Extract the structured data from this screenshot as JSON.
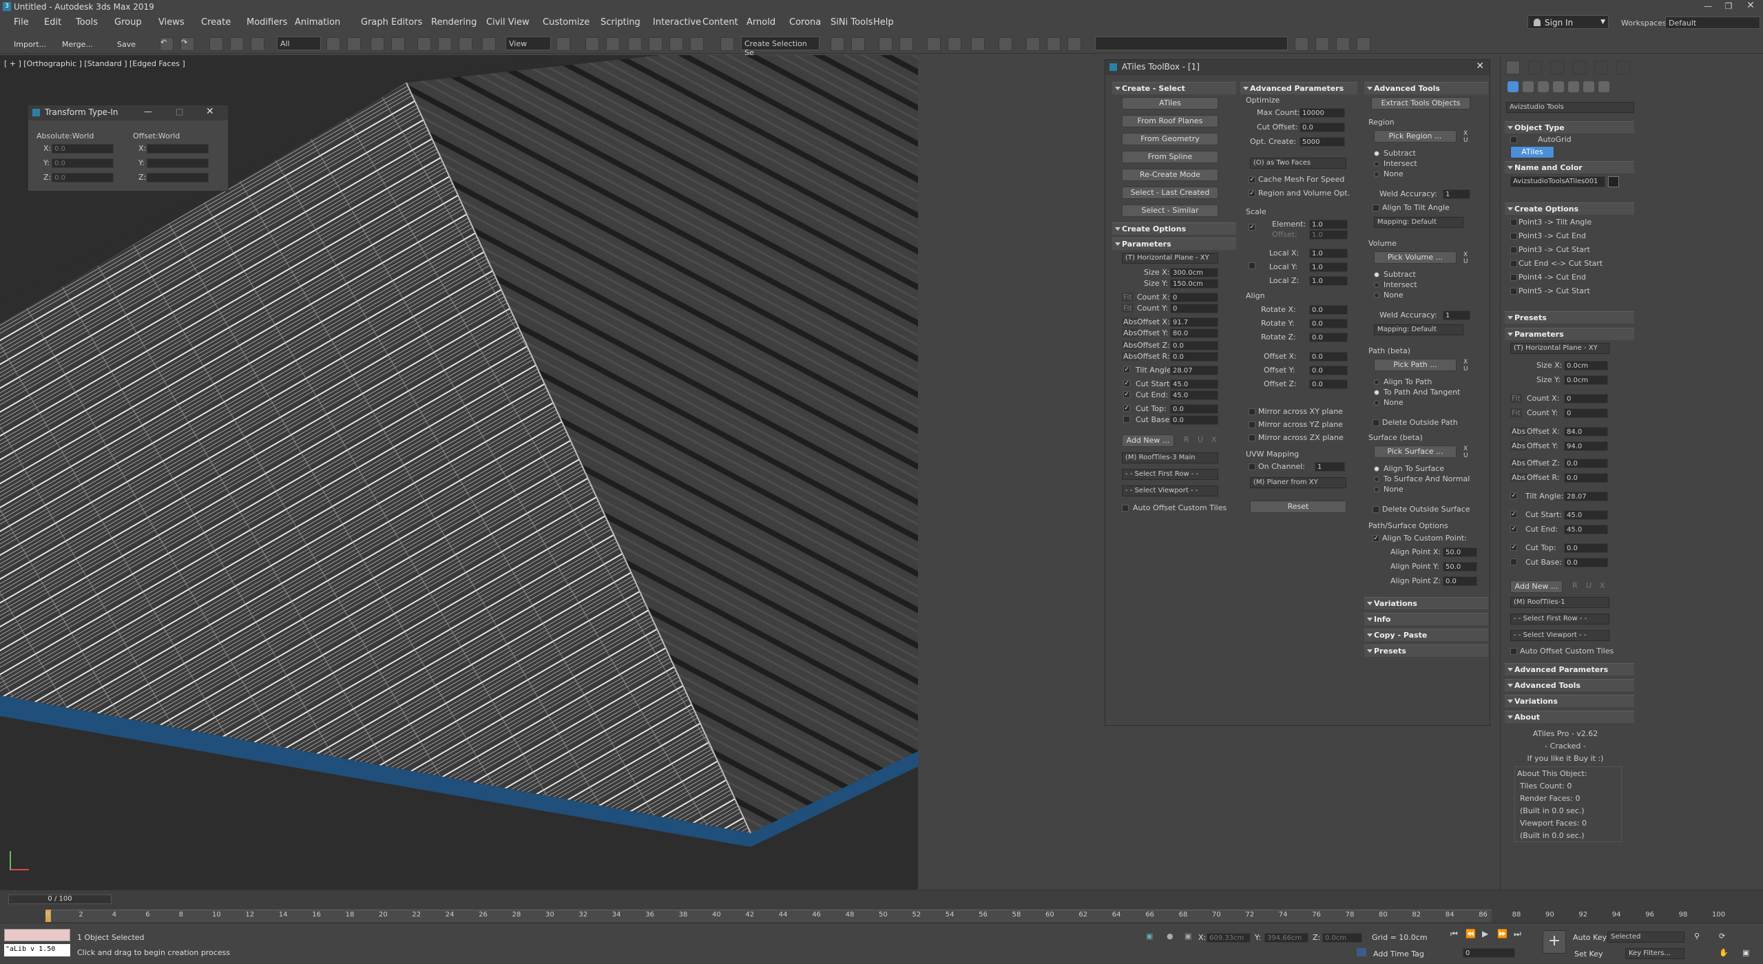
{
  "app": {
    "title": "Untitled - Autodesk 3ds Max 2019"
  },
  "menu": [
    "File",
    "Edit",
    "Tools",
    "Group",
    "Views",
    "Create",
    "Modifiers",
    "Animation",
    "Graph Editors",
    "Rendering",
    "Civil View",
    "Customize",
    "Scripting",
    "Interactive",
    "Content",
    "Arnold",
    "Corona",
    "SiNi Tools",
    "Help"
  ],
  "topright": {
    "signin": "Sign In",
    "workspaces_label": "Workspaces:",
    "workspaces_value": "Default"
  },
  "toolbar": {
    "import": "Import...",
    "merge": "Merge...",
    "save": "Save",
    "filter": "All",
    "refcoord": "View",
    "selset": "Create Selection Se"
  },
  "viewport": {
    "label": "[ + ] [Orthographic ] [Standard ] [Edged Faces ]"
  },
  "transform": {
    "title": "Transform Type-In",
    "abs_label": "Absolute:World",
    "off_label": "Offset:World",
    "abs": [
      {
        "axis": "X:",
        "val": "0.0"
      },
      {
        "axis": "Y:",
        "val": "0.0"
      },
      {
        "axis": "Z:",
        "val": "0.0"
      }
    ],
    "off": [
      {
        "axis": "X:",
        "val": ""
      },
      {
        "axis": "Y:",
        "val": ""
      },
      {
        "axis": "Z:",
        "val": ""
      }
    ]
  },
  "toolbox": {
    "title": "ATiles ToolBox - [1]",
    "col1": {
      "create_select": "Create - Select",
      "buttons": [
        "ATiles",
        "From Roof Planes",
        "From Geometry",
        "From Spline",
        "Re-Create Mode",
        "Select - Last Created",
        "Select - Similar"
      ],
      "create_options": "Create Options",
      "parameters": "Parameters",
      "plane": "(T) Horizontal Plane - XY",
      "params": [
        {
          "pre": "",
          "label": "Size X:",
          "val": "300.0cm"
        },
        {
          "pre": "",
          "label": "Size Y:",
          "val": "150.0cm"
        },
        {
          "pre": "Fit",
          "label": "Count X:",
          "val": "0"
        },
        {
          "pre": "Fit",
          "label": "Count Y:",
          "val": "0"
        },
        {
          "pre": "Abs",
          "label": "Offset X:",
          "val": "91.7"
        },
        {
          "pre": "Abs",
          "label": "Offset Y:",
          "val": "80.0"
        },
        {
          "pre": "Abs",
          "label": "Offset Z:",
          "val": "0.0"
        },
        {
          "pre": "Abs",
          "label": "Offset R:",
          "val": "0.0"
        },
        {
          "pre": "chk",
          "label": "Tilt Angle:",
          "val": "28.07"
        },
        {
          "pre": "chk",
          "label": "Cut Start:",
          "val": "45.0"
        },
        {
          "pre": "chk",
          "label": "Cut End:",
          "val": "45.0"
        },
        {
          "pre": "chk",
          "label": "Cut Top:",
          "val": "0.0"
        },
        {
          "pre": "box",
          "label": "Cut Base:",
          "val": "0.0"
        }
      ],
      "add_new": "Add New ...",
      "rux": [
        "R",
        "U",
        "X"
      ],
      "preset": "(M) RoofTiles-3 Main",
      "first_row": "- - Select First Row - -",
      "viewport_sel": "- - Select Viewport - -",
      "auto_offset": "Auto Offset Custom Tiles"
    },
    "col2": {
      "header": "Advanced Parameters",
      "optimize": "Optimize",
      "opt": [
        {
          "label": "Max Count:",
          "val": "10000"
        },
        {
          "label": "Cut Offset:",
          "val": "0.0"
        },
        {
          "label": "Opt. Create:",
          "val": "5000"
        }
      ],
      "faces": "(O) as Two Faces",
      "cache": "Cache Mesh For Speed",
      "region_opt": "Region and Volume Opt.",
      "scale": "Scale",
      "scale_rows": [
        {
          "label": "Element:",
          "val": "1.0"
        },
        {
          "label": "Offset:",
          "val": "1.0"
        },
        {
          "label": "Local X:",
          "val": "1.0"
        },
        {
          "label": "Local Y:",
          "val": "1.0"
        },
        {
          "label": "Local Z:",
          "val": "1.0"
        }
      ],
      "align": "Align",
      "align_rows": [
        {
          "label": "Rotate X:",
          "val": "0.0"
        },
        {
          "label": "Rotate Y:",
          "val": "0.0"
        },
        {
          "label": "Rotate Z:",
          "val": "0.0"
        },
        {
          "label": "Offset X:",
          "val": "0.0"
        },
        {
          "label": "Offset Y:",
          "val": "0.0"
        },
        {
          "label": "Offset Z:",
          "val": "0.0"
        }
      ],
      "mirrors": [
        "Mirror across XY plane",
        "Mirror across YZ plane",
        "Mirror across ZX plane"
      ],
      "uvw": "UVW Mapping",
      "on_channel": "On Channel:",
      "channel": "1",
      "planer": "(M) Planer from XY",
      "reset": "Reset"
    },
    "col3": {
      "header": "Advanced Tools",
      "extract": "Extract Tools Objects",
      "region": "Region",
      "pick_region": "Pick Region ...",
      "modes": [
        "Subtract",
        "Intersect",
        "None"
      ],
      "weld": "Weld Accuracy:",
      "weld_val": "1",
      "align_tilt": "Align To Tilt Angle",
      "mapping": "Mapping: Default",
      "volume": "Volume",
      "pick_volume": "Pick Volume ...",
      "path": "Path (beta)",
      "pick_path": "Pick Path ...",
      "path_opts": [
        "Align To Path",
        "To Path And Tangent",
        "None"
      ],
      "delete_path": "Delete Outside Path",
      "surface": "Surface (beta)",
      "pick_surface": "Pick Surface ...",
      "surf_opts": [
        "Align To Surface",
        "To Surface And Normal",
        "None"
      ],
      "delete_surface": "Delete Outside Surface",
      "ps_opts": "Path/Surface Options",
      "align_custom": "Align To Custom Point:",
      "align_pts": [
        {
          "label": "Align Point X:",
          "val": "50.0"
        },
        {
          "label": "Align Point Y:",
          "val": "50.0"
        },
        {
          "label": "Align Point Z:",
          "val": "0.0"
        }
      ],
      "rollouts": [
        "Variations",
        "Info",
        "Copy - Paste",
        "Presets"
      ],
      "xu": [
        "X",
        "U"
      ]
    }
  },
  "cmd": {
    "category": "Avizstudio Tools",
    "object_type": "Object Type",
    "autogrid": "AutoGrid",
    "atiles": "ATiles",
    "name_color": "Name and Color",
    "name": "AvizstudioToolsATiles001",
    "create_options": "Create Options",
    "create_list": [
      "Point3 -> Tilt Angle",
      "Point3 -> Cut End",
      "Point3 -> Cut Start",
      "Cut End <-> Cut Start",
      "Point4 -> Cut End",
      "Point5 -> Cut Start"
    ],
    "presets": "Presets",
    "parameters": "Parameters",
    "plane": "(T) Horizontal Plane - XY",
    "params": [
      {
        "pre": "",
        "label": "Size X:",
        "val": "0.0cm"
      },
      {
        "pre": "",
        "label": "Size Y:",
        "val": "0.0cm"
      },
      {
        "pre": "Fit",
        "label": "Count X:",
        "val": "0"
      },
      {
        "pre": "Fit",
        "label": "Count Y:",
        "val": "0"
      },
      {
        "pre": "Abs",
        "label": "Offset X:",
        "val": "84.0"
      },
      {
        "pre": "Abs",
        "label": "Offset Y:",
        "val": "94.0"
      },
      {
        "pre": "Abs",
        "label": "Offset Z:",
        "val": "0.0"
      },
      {
        "pre": "Abs",
        "label": "Offset R:",
        "val": "0.0"
      },
      {
        "pre": "chk",
        "label": "Tilt Angle:",
        "val": "28.07"
      },
      {
        "pre": "chk",
        "label": "Cut Start:",
        "val": "45.0"
      },
      {
        "pre": "chk",
        "label": "Cut End:",
        "val": "45.0"
      },
      {
        "pre": "chk",
        "label": "Cut Top:",
        "val": "0.0"
      },
      {
        "pre": "box",
        "label": "Cut Base:",
        "val": "0.0"
      }
    ],
    "add_new": "Add New ...",
    "rux": [
      "R",
      "U",
      "X"
    ],
    "preset": "(M) RoofTiles-1",
    "first_row": "- - Select First Row - -",
    "viewport_sel": "- - Select Viewport - -",
    "auto_offset": "Auto Offset Custom Tiles",
    "adv_params": "Advanced Parameters",
    "adv_tools": "Advanced Tools",
    "variations": "Variations",
    "about": "About",
    "about_lines": [
      "ATiles Pro - v2.62",
      "- Cracked -",
      "If you like it Buy it :)"
    ],
    "about_obj": [
      "About This Object:",
      "Tiles Count: 0",
      "Render Faces: 0",
      "(Built in 0.0 sec.)",
      "Viewport Faces: 0",
      "(Built in 0.0 sec.)"
    ]
  },
  "timeline": {
    "frame": "0 / 100",
    "ticks": [
      "0",
      "2",
      "4",
      "6",
      "8",
      "10",
      "12",
      "14",
      "16",
      "18",
      "20",
      "22",
      "24",
      "26",
      "28",
      "30",
      "32",
      "34",
      "36",
      "38",
      "40",
      "42",
      "44",
      "46",
      "48",
      "50",
      "52",
      "54",
      "56",
      "58",
      "60",
      "62",
      "64",
      "66",
      "68",
      "70",
      "72",
      "74",
      "76",
      "78",
      "80",
      "82",
      "84",
      "86",
      "88",
      "90",
      "92",
      "94",
      "96",
      "98",
      "100"
    ]
  },
  "status": {
    "maxscript": "\"aLib v 1.50",
    "selected": "1 Object Selected",
    "prompt": "Click and drag to begin creation process",
    "x_label": "X:",
    "x": "609.33cm",
    "y_label": "Y:",
    "y": "394.66cm",
    "z_label": "Z:",
    "z": "0.0cm",
    "grid": "Grid = 10.0cm",
    "addtime": "Add Time Tag",
    "autokey": "Auto Key",
    "setkey": "Set Key",
    "selected_dd": "Selected",
    "keyfilters": "Key Filters...",
    "frame_field": "0"
  }
}
